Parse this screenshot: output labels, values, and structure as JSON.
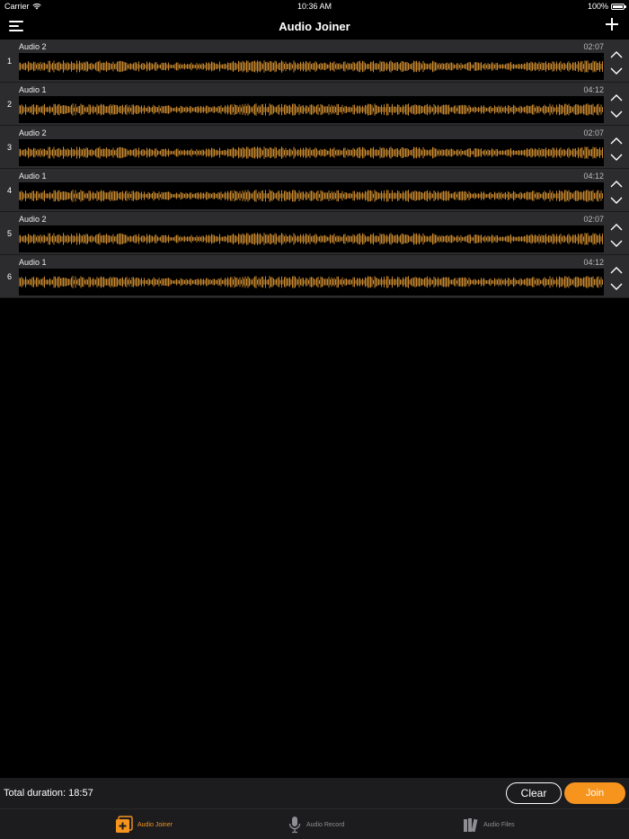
{
  "status_bar": {
    "carrier": "Carrier",
    "time": "10:36 AM",
    "battery": "100%"
  },
  "nav": {
    "title": "Audio Joiner"
  },
  "colors": {
    "accent": "#f7941d",
    "waveform": "#c8892e",
    "row_bg": "#2c2c2e"
  },
  "tracks": [
    {
      "index": "1",
      "name": "Audio 2",
      "duration": "02:07"
    },
    {
      "index": "2",
      "name": "Audio 1",
      "duration": "04:12"
    },
    {
      "index": "3",
      "name": "Audio 2",
      "duration": "02:07"
    },
    {
      "index": "4",
      "name": "Audio 1",
      "duration": "04:12"
    },
    {
      "index": "5",
      "name": "Audio 2",
      "duration": "02:07"
    },
    {
      "index": "6",
      "name": "Audio 1",
      "duration": "04:12"
    }
  ],
  "footer": {
    "total_duration": "Total duration: 18:57",
    "clear_label": "Clear",
    "join_label": "Join"
  },
  "tabs": [
    {
      "label": "Audio Joiner",
      "icon": "joiner-icon",
      "active": true
    },
    {
      "label": "Audio Record",
      "icon": "microphone-icon",
      "active": false
    },
    {
      "label": "Audio Files",
      "icon": "files-icon",
      "active": false
    }
  ]
}
